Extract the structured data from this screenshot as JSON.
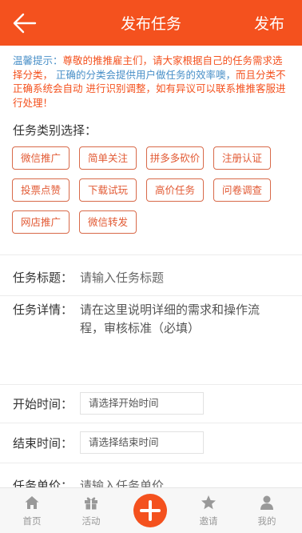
{
  "header": {
    "title": "发布任务",
    "publish_label": "发布"
  },
  "tip": {
    "part1": "温馨提示：",
    "part2": "尊敬的推推雇主们，请大家根据自己的任务需求选择分类，",
    "part3": " 正确的分类会提供用户做任务的效率噢，",
    "part4": "而且分类不正确系统会自动 进行识别调整，如有异议可以联系推推客服进行处理！"
  },
  "category": {
    "label": "任务类别选择：",
    "items": [
      "微信推广",
      "简单关注",
      "拼多多砍价",
      "注册认证",
      "投票点赞",
      "下载试玩",
      "高价任务",
      "问卷调查",
      "网店推广",
      "微信转发"
    ]
  },
  "form": {
    "title_label": "任务标题：",
    "title_placeholder": "请输入任务标题",
    "detail_label": "任务详情：",
    "detail_placeholder": "请在这里说明详细的需求和操作流程，审核标准（必填）",
    "start_label": "开始时间：",
    "start_placeholder": "请选择开始时间",
    "end_label": "结束时间：",
    "end_placeholder": "请选择结束时间",
    "price_label": "任务单价：",
    "price_placeholder": "请输入任务单价"
  },
  "tabbar": {
    "items": [
      {
        "label": "首页",
        "icon": "home-icon"
      },
      {
        "label": "活动",
        "icon": "gift-icon"
      },
      {
        "label": "邀请",
        "icon": "star-icon"
      },
      {
        "label": "我的",
        "icon": "user-icon"
      }
    ],
    "center_icon": "plus-icon"
  },
  "colors": {
    "accent": "#f4511e",
    "tip_blue": "#4a90c8",
    "tag_border": "#d86a4a"
  }
}
